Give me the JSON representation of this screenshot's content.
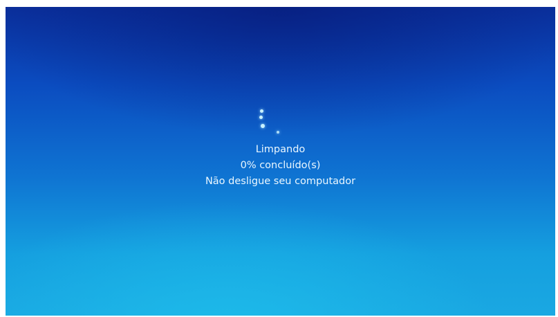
{
  "screen": {
    "status_title": "Limpando",
    "progress_text": "0% concluído(s)",
    "warning_text": "Não desligue seu computador",
    "progress_percent": 0
  },
  "colors": {
    "background_top": "#0a2f9c",
    "background_bottom": "#1aa8e2",
    "text": "#eaf7ff",
    "spinner_dots": "#c9f2ff"
  },
  "icons": {
    "spinner": "loading-spinner-icon"
  }
}
